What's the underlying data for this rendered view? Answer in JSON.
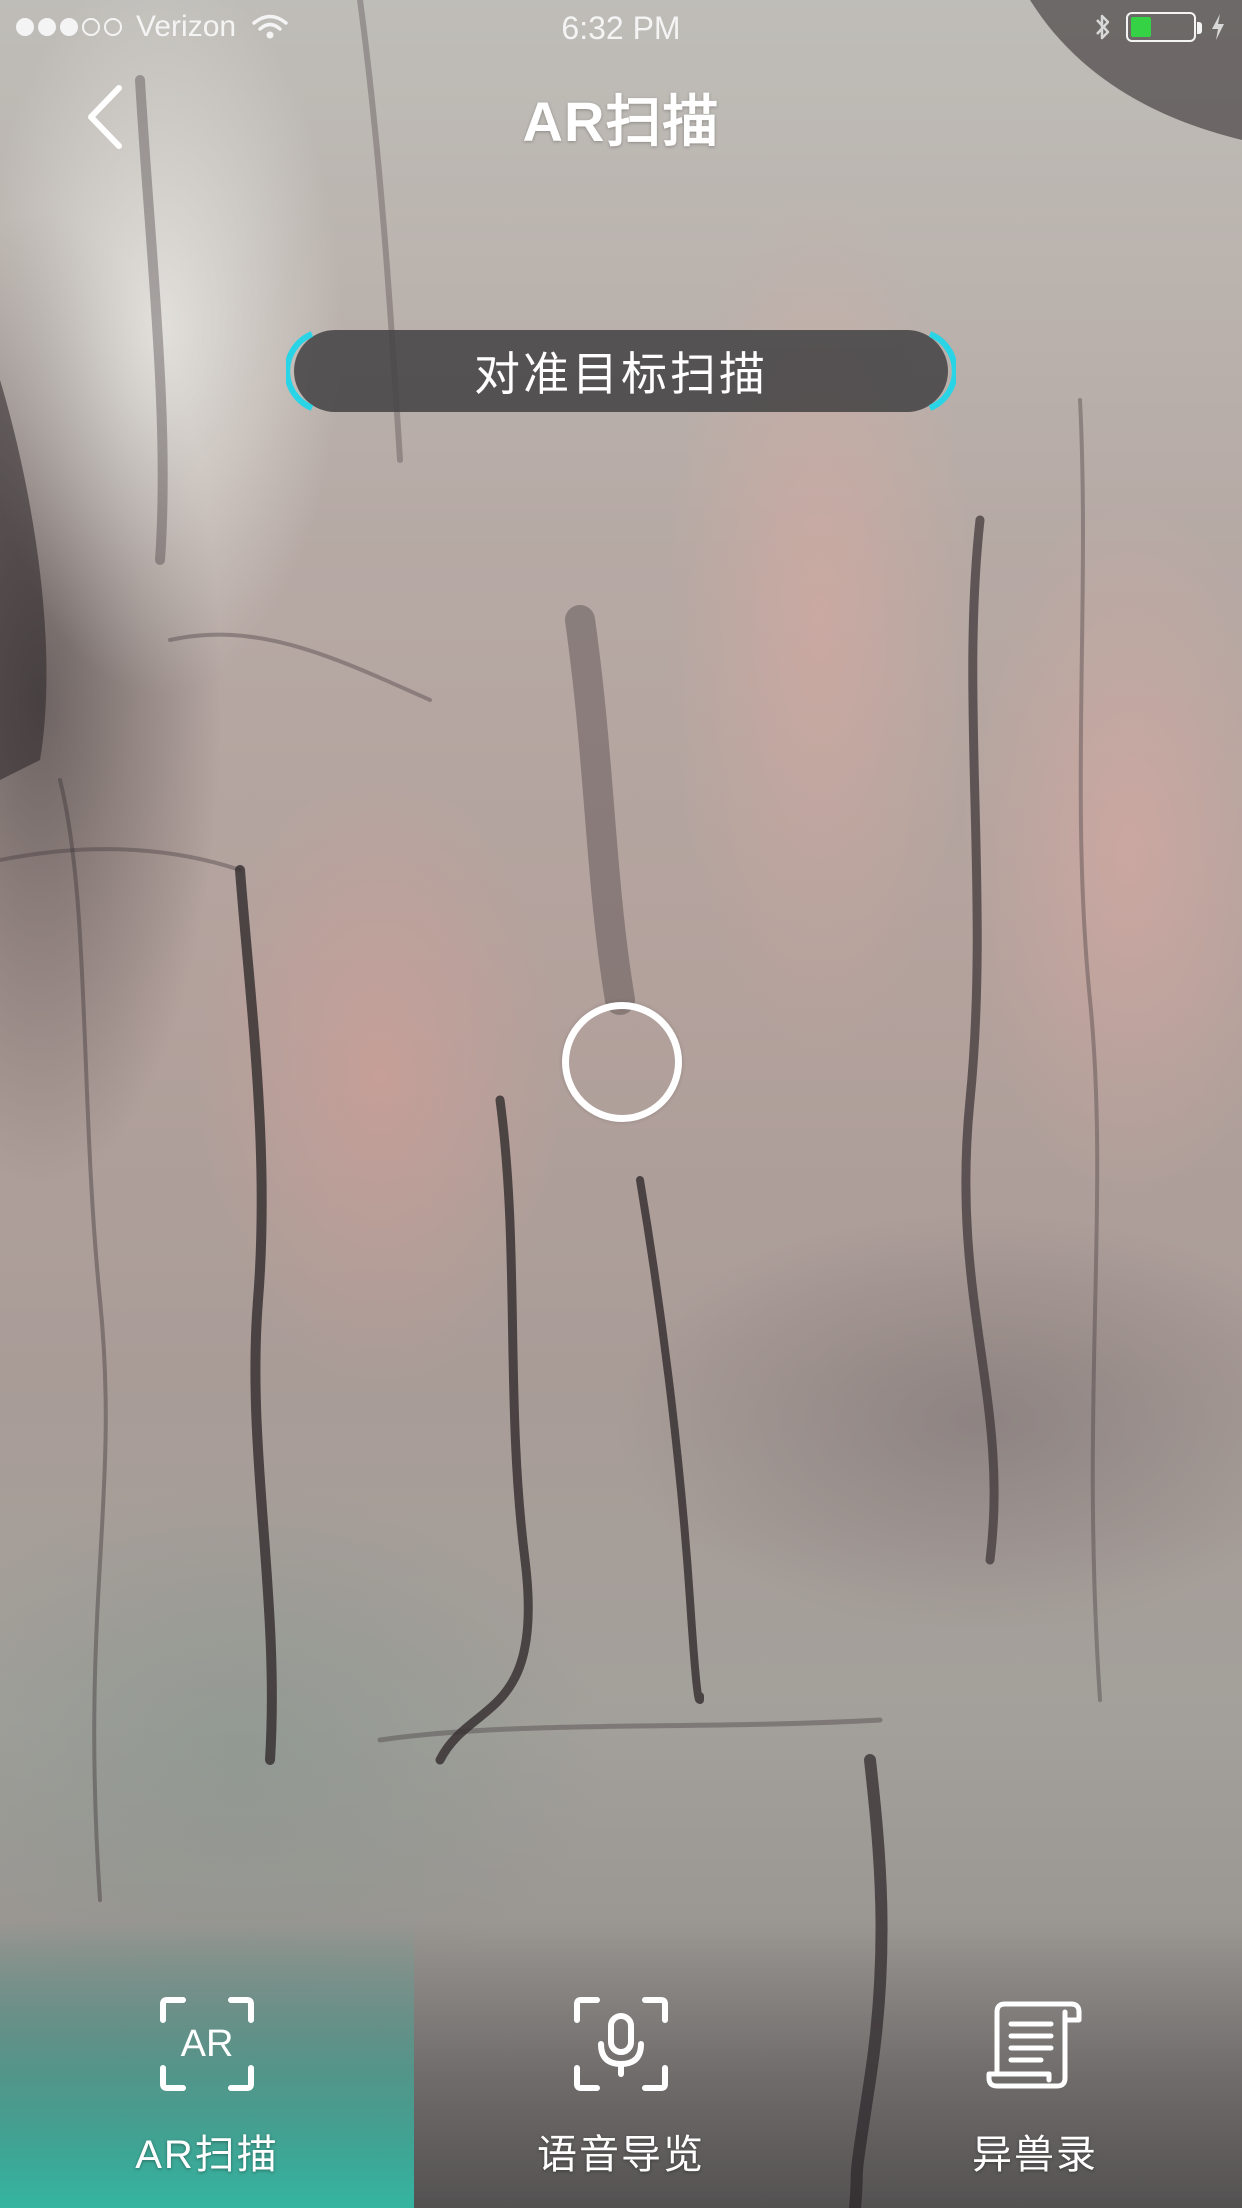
{
  "status_bar": {
    "carrier": "Verizon",
    "time": "6:32 PM",
    "signal_bars_filled": 3,
    "signal_bars_total": 5,
    "battery_level": 0.3,
    "battery_color": "#36d246",
    "icons": [
      "wifi-icon",
      "bluetooth-icon",
      "battery-icon",
      "charging-bolt-icon"
    ]
  },
  "nav": {
    "back_icon": "chevron-left-icon",
    "title": "AR扫描"
  },
  "scan_hint": {
    "text": "对准目标扫描",
    "bracket_color": "#29d4e6"
  },
  "reticle": {
    "icon": "scan-reticle-circle"
  },
  "tabs": [
    {
      "label": "AR扫描",
      "icon": "ar-scan-icon",
      "active": true
    },
    {
      "label": "语音导览",
      "icon": "voice-guide-icon",
      "active": false
    },
    {
      "label": "异兽录",
      "icon": "scroll-icon",
      "active": false
    }
  ],
  "colors": {
    "active_tab": "#32bea8",
    "text": "#ffffff"
  }
}
